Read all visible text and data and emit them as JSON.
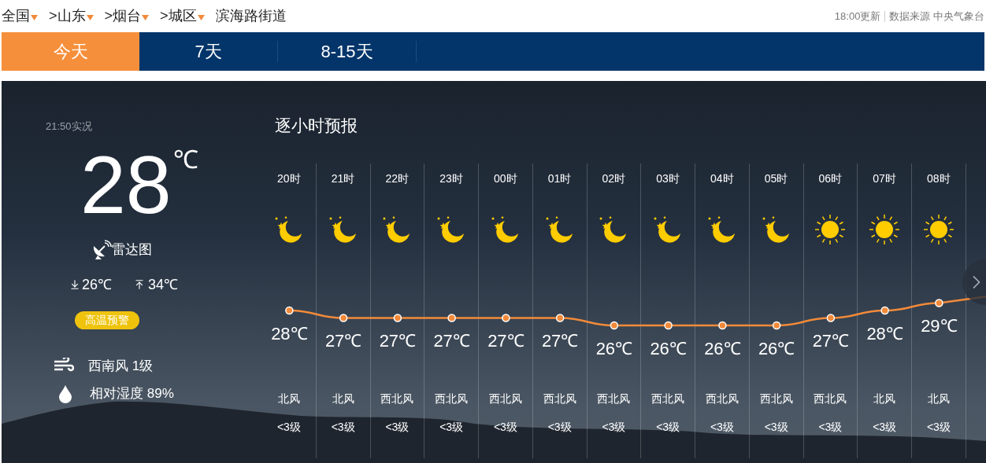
{
  "breadcrumb": [
    {
      "label": "全国",
      "dropdown": true
    },
    {
      "label": ">山东",
      "dropdown": true
    },
    {
      "label": ">烟台",
      "dropdown": true
    },
    {
      "label": ">城区",
      "dropdown": true
    },
    {
      "label": "滨海路街道",
      "dropdown": false
    }
  ],
  "update_time": "18:00更新",
  "source": "数据来源 中央气象台",
  "tabs": [
    {
      "label": "今天",
      "selected": true
    },
    {
      "label": "7天",
      "selected": false
    },
    {
      "label": "8-15天",
      "selected": false
    }
  ],
  "current": {
    "observed": "21:50实况",
    "temperature": "28",
    "unit": "℃",
    "radar": "雷达图",
    "low": "26℃",
    "high": "34℃",
    "alert": "高温预警",
    "wind": "西南风 1级",
    "humidity": "相对湿度 89%"
  },
  "hourly": {
    "title": "逐小时预报",
    "hours": [
      {
        "kind": "moon",
        "wind_direction": "北风",
        "wind_level": "<3级"
      },
      {
        "kind": "moon",
        "wind_direction": "北风",
        "wind_level": "<3级"
      },
      {
        "kind": "moon",
        "wind_direction": "西北风",
        "wind_level": "<3级"
      },
      {
        "kind": "moon",
        "wind_direction": "西北风",
        "wind_level": "<3级"
      },
      {
        "kind": "moon",
        "wind_direction": "西北风",
        "wind_level": "<3级"
      },
      {
        "kind": "moon",
        "wind_direction": "西北风",
        "wind_level": "<3级"
      },
      {
        "kind": "moon",
        "wind_direction": "西北风",
        "wind_level": "<3级"
      },
      {
        "kind": "moon",
        "wind_direction": "西北风",
        "wind_level": "<3级"
      },
      {
        "kind": "moon",
        "wind_direction": "西北风",
        "wind_level": "<3级"
      },
      {
        "kind": "moon",
        "wind_direction": "西北风",
        "wind_level": "<3级"
      },
      {
        "kind": "sun",
        "wind_direction": "西北风",
        "wind_level": "<3级"
      },
      {
        "kind": "sun",
        "wind_direction": "北风",
        "wind_level": "<3级"
      },
      {
        "kind": "sun",
        "wind_direction": "北风",
        "wind_level": "<3级"
      }
    ],
    "chart_data": {
      "type": "line",
      "categories": [
        "20时",
        "21时",
        "22时",
        "23时",
        "00时",
        "01时",
        "02时",
        "03时",
        "04时",
        "05时",
        "06时",
        "07时",
        "08时"
      ],
      "series": [
        {
          "color": "#f28a3a",
          "values": [
            28,
            27,
            27,
            27,
            27,
            27,
            26,
            26,
            26,
            26,
            27,
            28,
            29
          ]
        }
      ],
      "marker": true,
      "data_labels": true
    },
    "label_unit": "℃"
  }
}
